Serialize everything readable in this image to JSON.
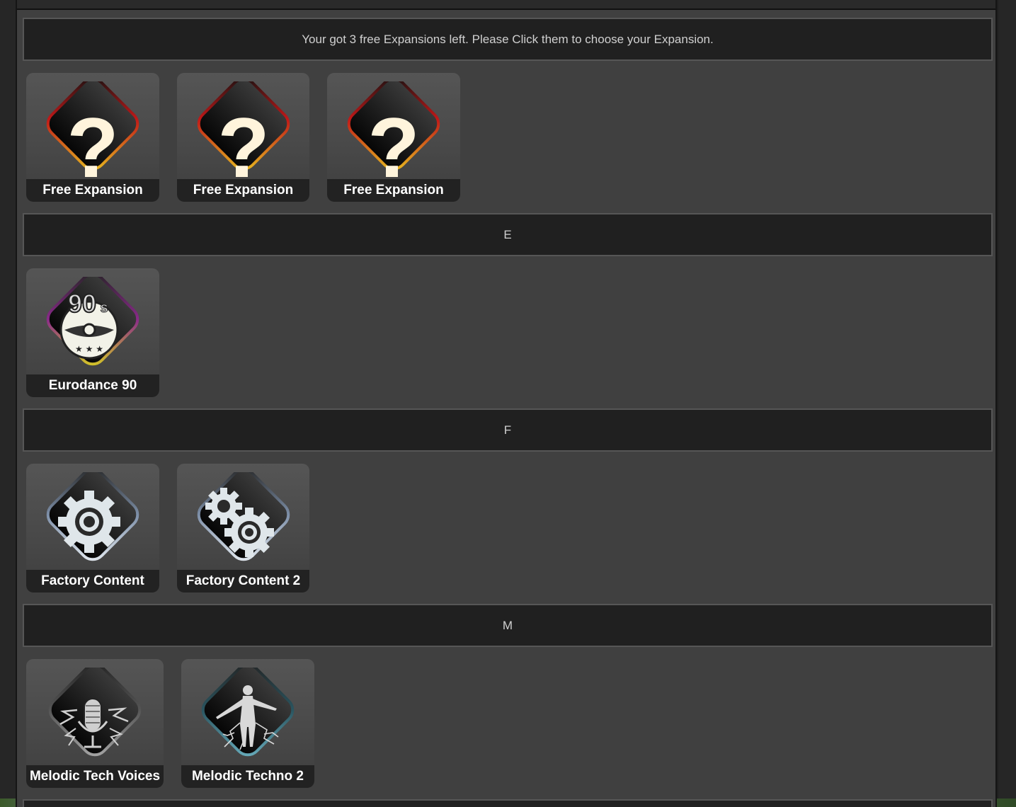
{
  "notice": "Your got 3 free Expansions left. Please Click them to choose your Expansion.",
  "free_tiles": [
    {
      "label": "Free Expansion",
      "icon": "question-mark-icon"
    },
    {
      "label": "Free Expansion",
      "icon": "question-mark-icon"
    },
    {
      "label": "Free Expansion",
      "icon": "question-mark-icon"
    }
  ],
  "sections": [
    {
      "letter": "E",
      "items": [
        {
          "label": "Eurodance 90",
          "icon": "90s-disc-icon"
        }
      ]
    },
    {
      "letter": "F",
      "items": [
        {
          "label": "Factory Content",
          "icon": "gear-icon"
        },
        {
          "label": "Factory Content 2",
          "icon": "double-gear-icon"
        }
      ]
    },
    {
      "letter": "M",
      "items": [
        {
          "label": "Melodic Tech Voices",
          "icon": "microphone-icon"
        },
        {
          "label": "Melodic Techno 2",
          "icon": "figure-lightning-icon"
        }
      ]
    }
  ],
  "colors": {
    "panel": "#404040",
    "header": "#202020",
    "glow_red": "#c01818",
    "glow_yellow": "#e8c020"
  }
}
